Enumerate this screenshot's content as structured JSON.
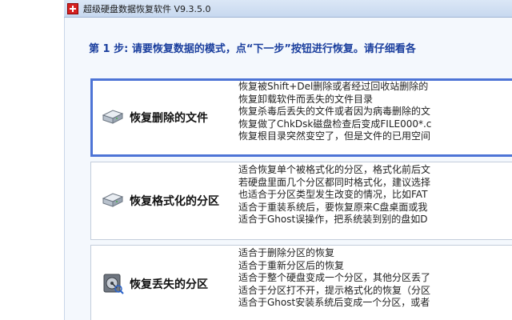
{
  "window": {
    "title": "超级硬盘数据恢复软件 V9.3.5.0"
  },
  "instruction": "第 1 步:  请要恢复数据的模式，点“下一步”按钮进行恢复。请仔细看各",
  "options": [
    {
      "label": "恢复删除的文件",
      "icon": "hard-disk-icon",
      "selected": true,
      "lines": [
        "恢复被Shift+Del删除或者经过回收站删除的",
        "恢复卸载软件而丢失的文件目录",
        "恢复杀毒后丢失的文件或者因为病毒删除的文",
        "恢复做了ChkDsk磁盘检查后变成FILE000*.c",
        "恢复根目录突然变空了，但是文件的已用空间"
      ]
    },
    {
      "label": "恢复格式化的分区",
      "icon": "hard-disk-icon",
      "selected": false,
      "lines": [
        "适合恢复单个被格式化的分区，格式化前后文",
        "若硬盘里面几个分区都同时格式化，建议选择",
        "也适合于分区类型发生改变的情况，比如FAT",
        "适合于重装系统后，要恢复原来C盘桌面或我",
        "适合于Ghost误操作，把系统装到别的盘如D"
      ]
    },
    {
      "label": "恢复丢失的分区",
      "icon": "disk-search-icon",
      "selected": false,
      "lines": [
        "适合于删除分区的恢复",
        "适合于重新分区后的恢复",
        "适合于整个硬盘变成一个分区，其他分区丢了",
        "适合于分区打不开，提示格式化的恢复（分区",
        "适合于Ghost安装系统后变成一个分区，或者"
      ]
    }
  ]
}
